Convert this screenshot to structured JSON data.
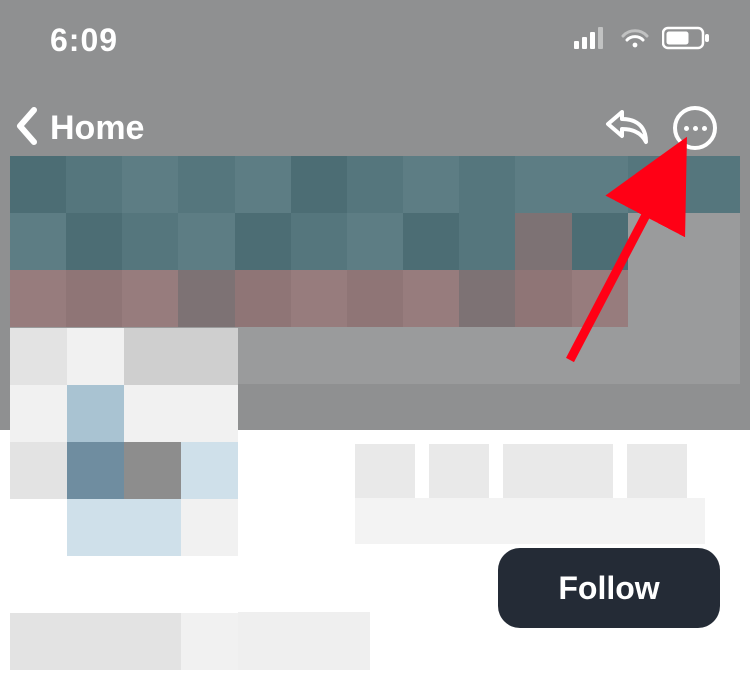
{
  "status": {
    "time": "6:09"
  },
  "nav": {
    "back_label": "Home"
  },
  "actions": {
    "follow_label": "Follow"
  },
  "annotation": {
    "arrow_target": "more-options-button",
    "arrow_color": "#ff0015"
  }
}
